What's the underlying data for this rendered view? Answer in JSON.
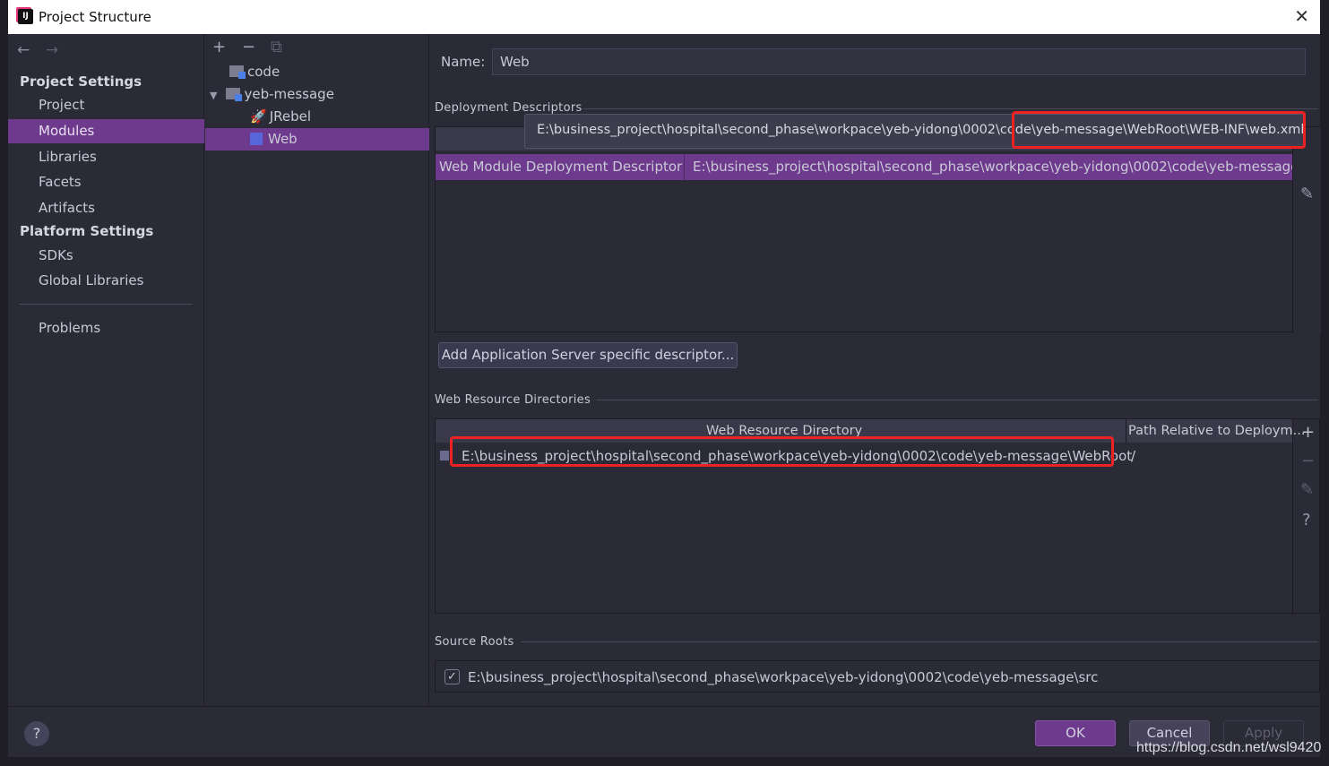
{
  "window": {
    "title": "Project Structure",
    "close_icon": "close-icon"
  },
  "sidebar": {
    "project_settings": "Project Settings",
    "platform_settings": "Platform Settings",
    "items": [
      {
        "label": "Project"
      },
      {
        "label": "Modules",
        "selected": true
      },
      {
        "label": "Libraries"
      },
      {
        "label": "Facets"
      },
      {
        "label": "Artifacts"
      }
    ],
    "platform_items": [
      {
        "label": "SDKs"
      },
      {
        "label": "Global Libraries"
      }
    ],
    "problems": "Problems"
  },
  "tree": {
    "nodes": [
      {
        "label": "code",
        "icon": "module-folder-icon"
      },
      {
        "label": "yeb-message",
        "icon": "module-folder-icon",
        "expanded": true
      },
      {
        "label": "JRebel",
        "icon": "jrebel-icon"
      },
      {
        "label": "Web",
        "icon": "web-facet-icon",
        "selected": true
      }
    ]
  },
  "main": {
    "name_label": "Name:",
    "name_value": "Web",
    "deployment_title": "Deployment Descriptors",
    "tooltip": "E:\\business_project\\hospital\\second_phase\\workpace\\yeb-yidong\\0002\\code\\yeb-message\\WebRoot\\WEB-INF\\web.xml",
    "descriptor_type": "Web Module Deployment Descriptor",
    "descriptor_path": "E:\\business_project\\hospital\\second_phase\\workpace\\yeb-yidong\\0002\\code\\yeb-message\\WebRoot\\",
    "add_server_btn": "Add Application Server specific descriptor...",
    "web_res_title": "Web Resource Directories",
    "col_dir": "Web Resource Directory",
    "col_rel": "Path Relative to Deploym...",
    "res_dir": "E:\\business_project\\hospital\\second_phase\\workpace\\yeb-yidong\\0002\\code\\yeb-message\\WebRoot",
    "res_rel": "/",
    "source_title": "Source Roots",
    "source_path": "E:\\business_project\\hospital\\second_phase\\workpace\\yeb-yidong\\0002\\code\\yeb-message\\src",
    "source_checked": true
  },
  "footer": {
    "ok": "OK",
    "cancel": "Cancel",
    "apply": "Apply",
    "help": "?",
    "watermark": "https://blog.csdn.net/wsl9420"
  },
  "colors": {
    "accent": "#6e3a8d",
    "highlight": "#ee2222",
    "background": "#2b2a37"
  }
}
